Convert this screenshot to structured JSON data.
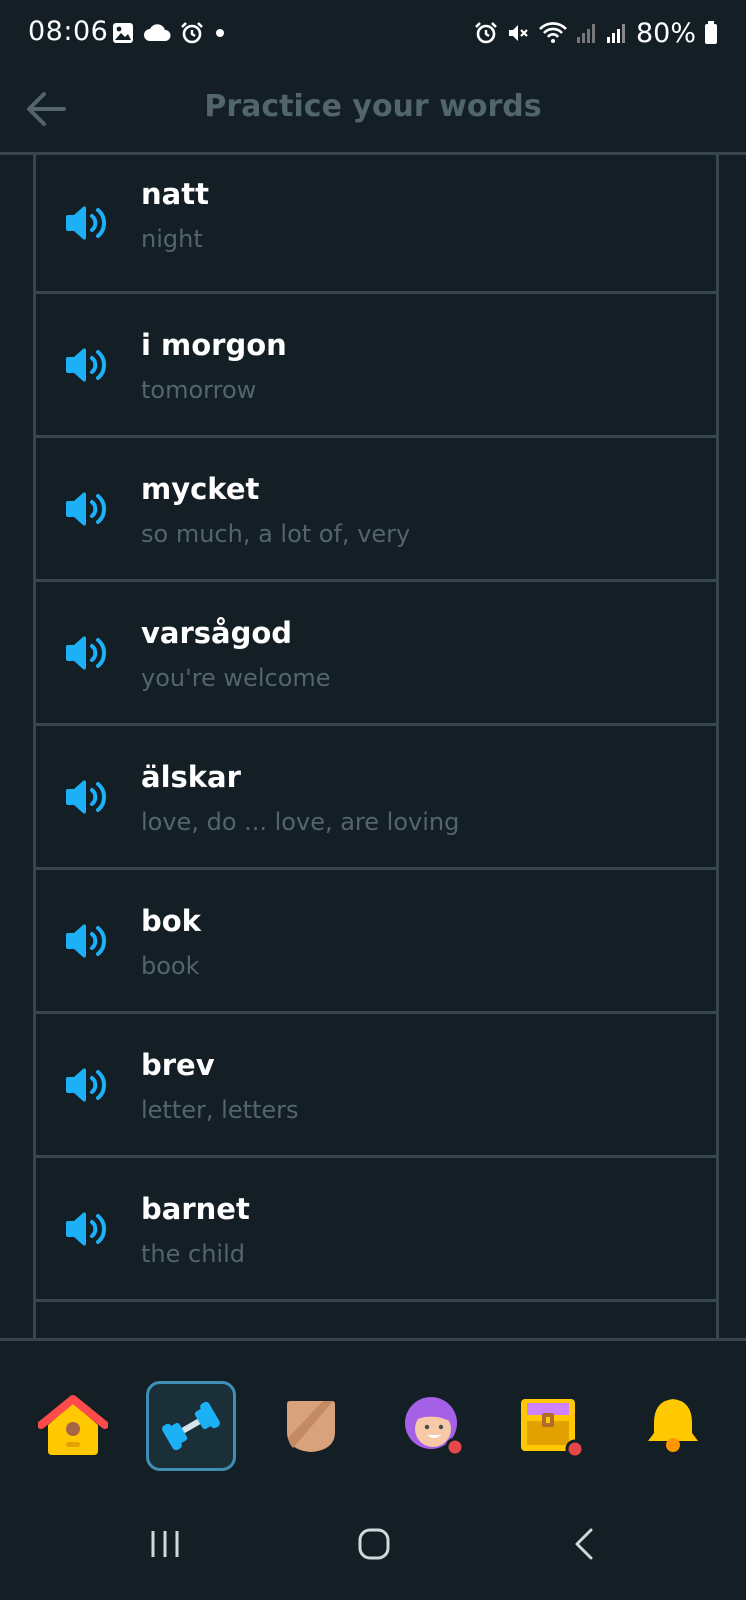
{
  "status_bar": {
    "time": "08:06",
    "battery": "80%"
  },
  "header": {
    "title": "Practice your words"
  },
  "words": [
    {
      "word": "natt",
      "translation": "night"
    },
    {
      "word": "i morgon",
      "translation": "tomorrow"
    },
    {
      "word": "mycket",
      "translation": "so much, a lot of, very"
    },
    {
      "word": "varsågod",
      "translation": "you're welcome"
    },
    {
      "word": "älskar",
      "translation": "love, do ... love, are loving"
    },
    {
      "word": "bok",
      "translation": "book"
    },
    {
      "word": "brev",
      "translation": "letter, letters"
    },
    {
      "word": "barnet",
      "translation": "the child"
    }
  ],
  "bottom_nav": {
    "items": [
      {
        "icon": "home-icon",
        "active": false
      },
      {
        "icon": "practice-dumbbell-icon",
        "active": true
      },
      {
        "icon": "league-shield-icon",
        "active": false
      },
      {
        "icon": "profile-avatar-icon",
        "active": false
      },
      {
        "icon": "treasure-chest-icon",
        "active": false
      },
      {
        "icon": "bell-icon",
        "active": false
      }
    ]
  },
  "colors": {
    "background": "#131f24",
    "divider": "#37464f",
    "accent_blue": "#1cb0f6",
    "muted_text": "#52656d",
    "active_nav_border": "#3f8fb5"
  }
}
